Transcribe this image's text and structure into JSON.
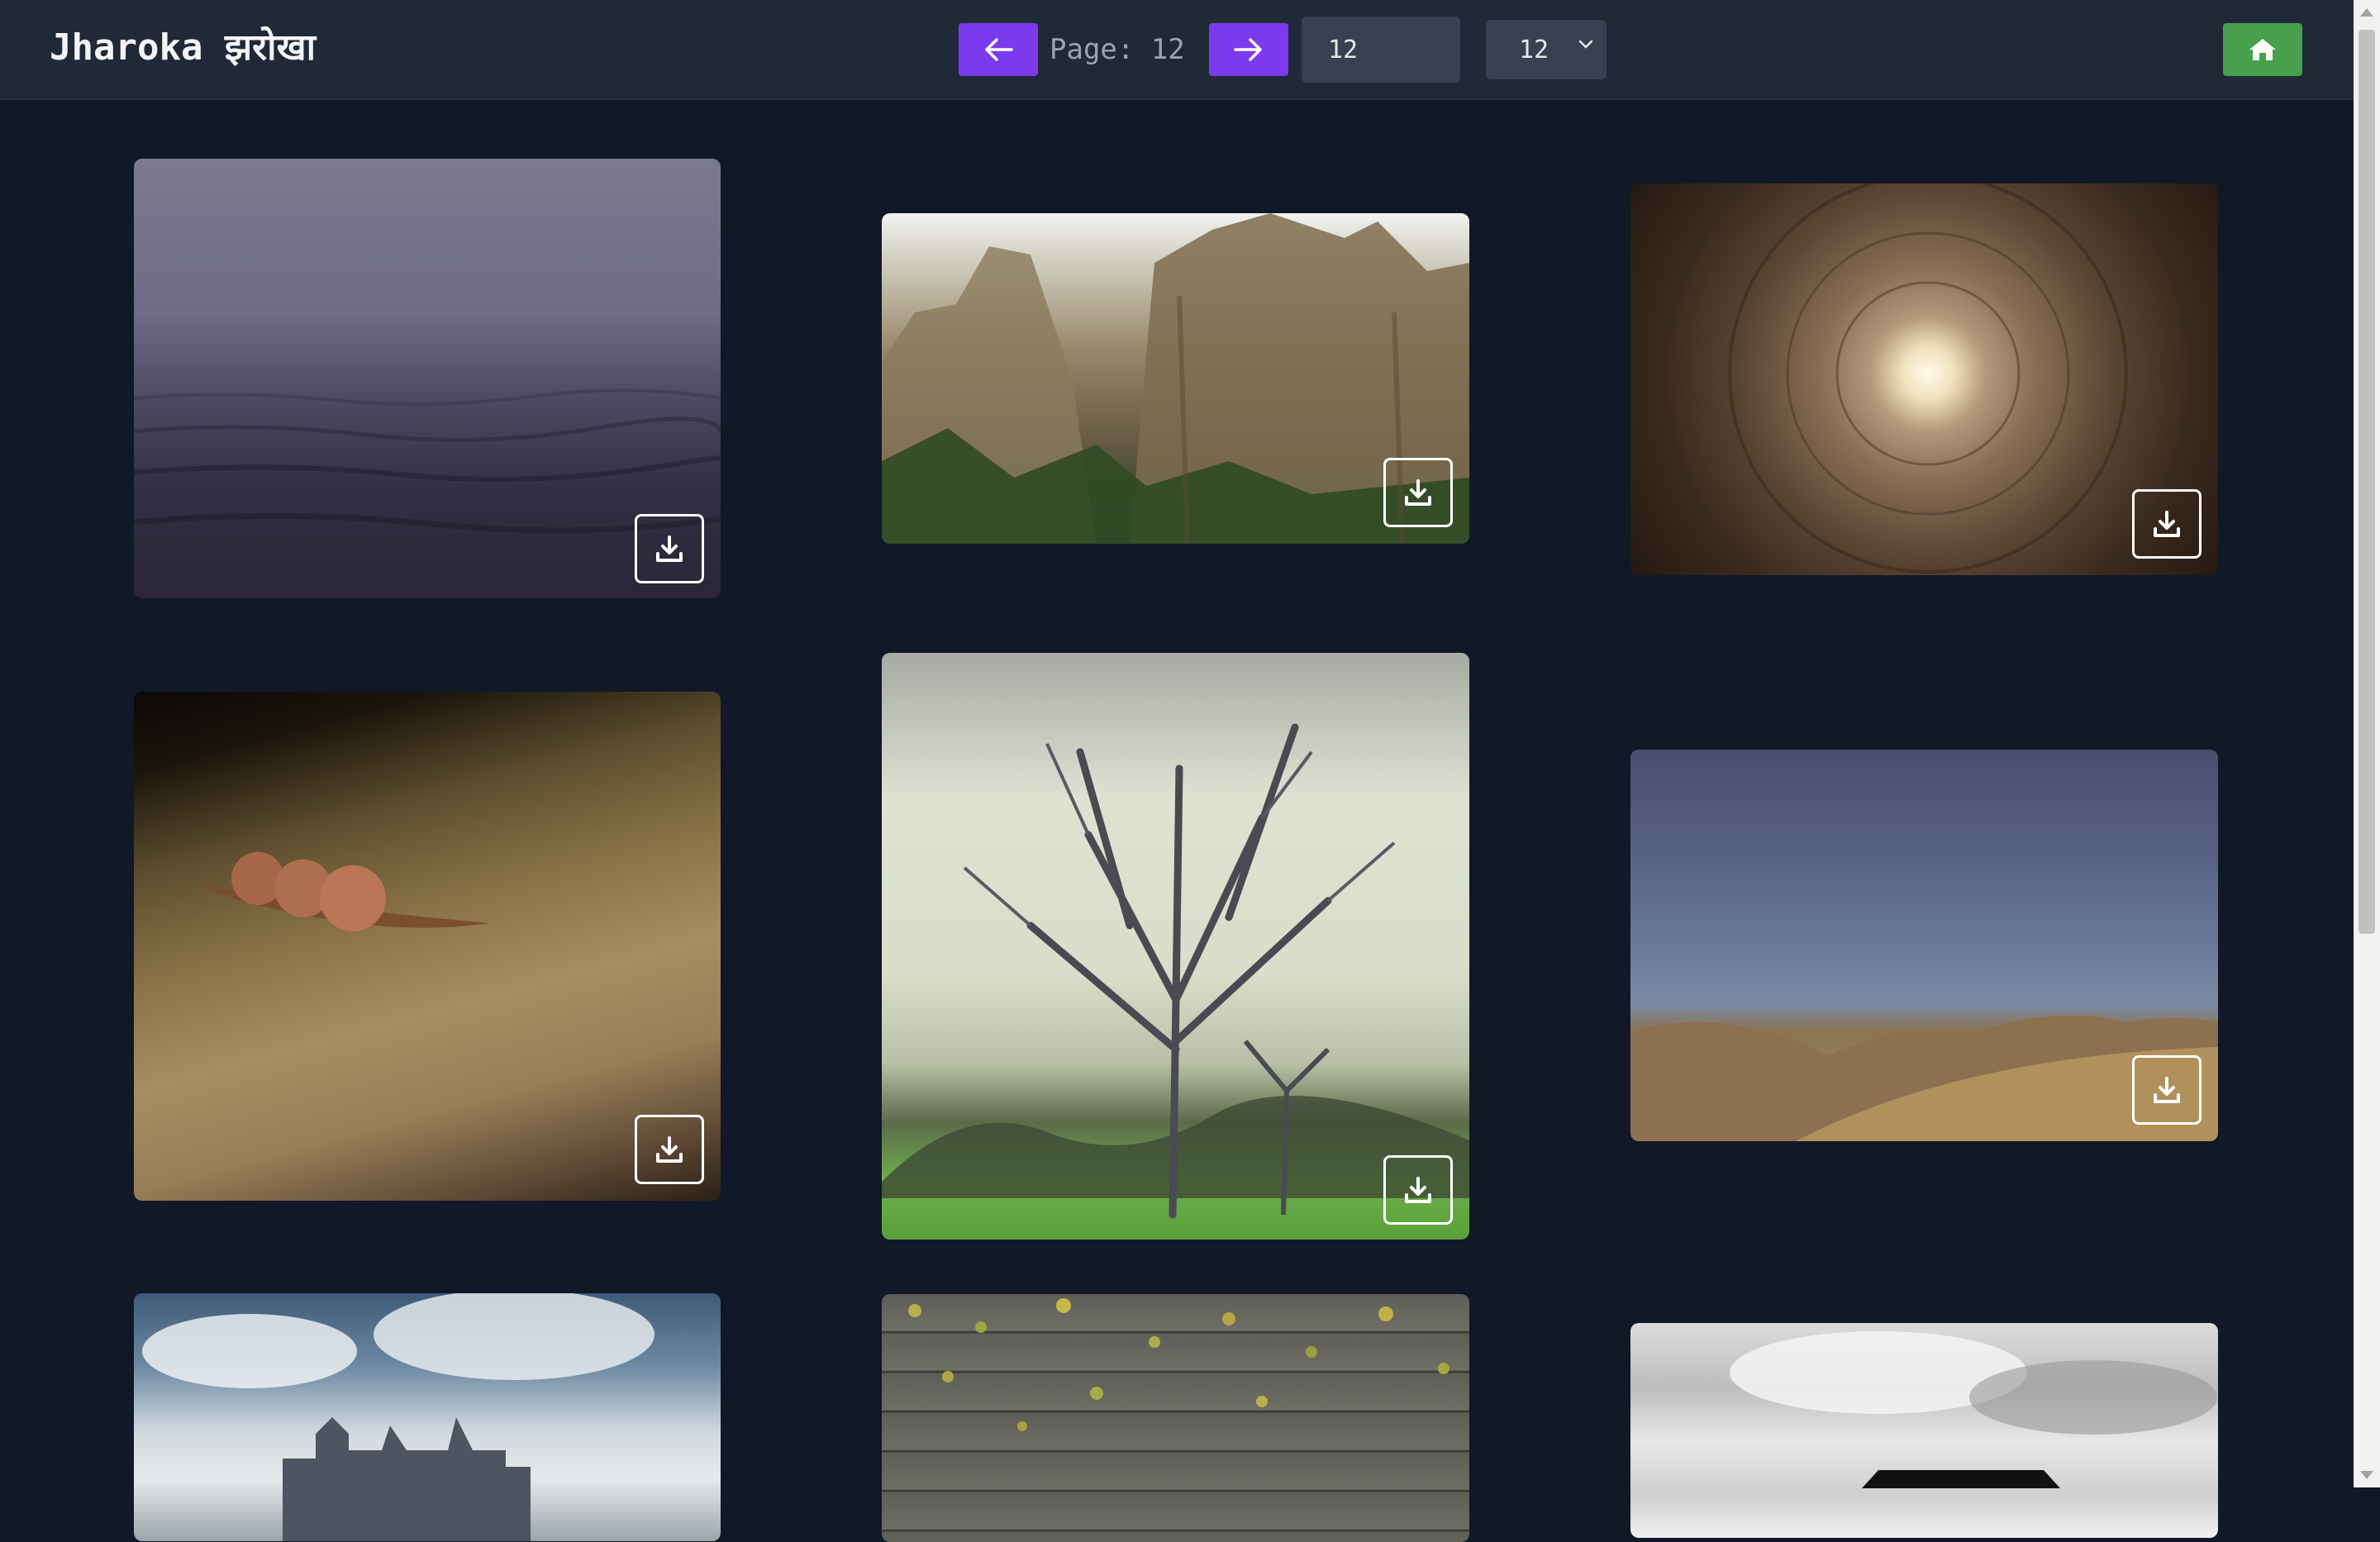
{
  "header": {
    "logo": "Jharoka झरोखा",
    "page_label": "Page: 12",
    "page_input_value": "12",
    "per_page_value": "12",
    "prev_icon": "arrow-left-icon",
    "next_icon": "arrow-right-icon",
    "home_icon": "home-icon",
    "accent_color": "#7c3aed",
    "home_color": "#47a04b"
  },
  "gallery": {
    "download_icon": "download-icon",
    "cards": [
      {
        "subject": "foggy-sea"
      },
      {
        "subject": "sandstone-cliffs"
      },
      {
        "subject": "tunnel-light"
      },
      {
        "subject": "seeds-on-wood"
      },
      {
        "subject": "bare-tree"
      },
      {
        "subject": "golden-hills"
      },
      {
        "subject": "chateau-clouds"
      },
      {
        "subject": "leaves-on-planks"
      },
      {
        "subject": "bw-house-clouds"
      }
    ]
  }
}
